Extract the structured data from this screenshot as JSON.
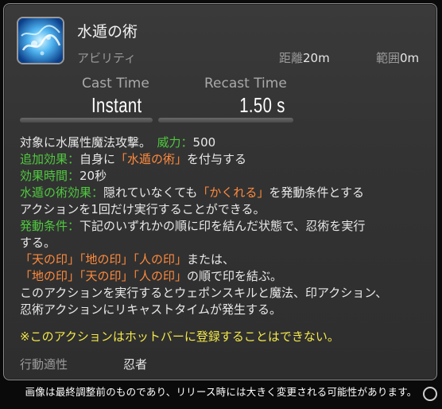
{
  "action": {
    "name": "水遁の術",
    "category": "アビリティ",
    "range_label": "距離",
    "range_value": "20m",
    "radius_label": "範囲",
    "radius_value": "0m",
    "icon": "water-splash-icon"
  },
  "timing": {
    "cast_label": "Cast Time",
    "cast_value": "Instant",
    "recast_label": "Recast Time",
    "recast_value": "1.50 s"
  },
  "description": {
    "l1_a": "対象に水属性魔法攻撃。",
    "l1_b": "威力：",
    "l1_c": "500",
    "l2_a": "追加効果：",
    "l2_b": "自身に",
    "l2_c": "「水遁の術」",
    "l2_d": "を付与する",
    "l3_a": "効果時間：",
    "l3_b": "20秒",
    "l4_a": "水遁の術効果：",
    "l4_b": "隠れていなくても",
    "l4_c": "「かくれる」",
    "l4_d": "を発動条件とする",
    "l5": "アクションを1回だけ実行することができる。",
    "l6_a": "発動条件：",
    "l6_b": "下記のいずれかの順に印を結んだ状態で、忍術を実行",
    "l7": "する。",
    "l8_a": "「天の印」「地の印」「人の印」",
    "l8_b": "または、",
    "l9_a": "「地の印」「天の印」「人の印」",
    "l9_b": "の順で印を結ぶ。",
    "l10": "このアクションを実行するとウェポンスキルと魔法、印アクション、",
    "l11": "忍術アクションにリキャストタイムが発生する。",
    "note": "※このアクションはホットバーに登録することはできない。"
  },
  "footer": {
    "job_label": "行動適性",
    "job_value": "忍者"
  },
  "caption": "画像は最終調整前のものであり、リリース時には大きく変更される可能性があります。",
  "colors": {
    "effect_label": "#4fc93f",
    "status_name": "#ff8a3d",
    "note": "#f2e84a"
  }
}
